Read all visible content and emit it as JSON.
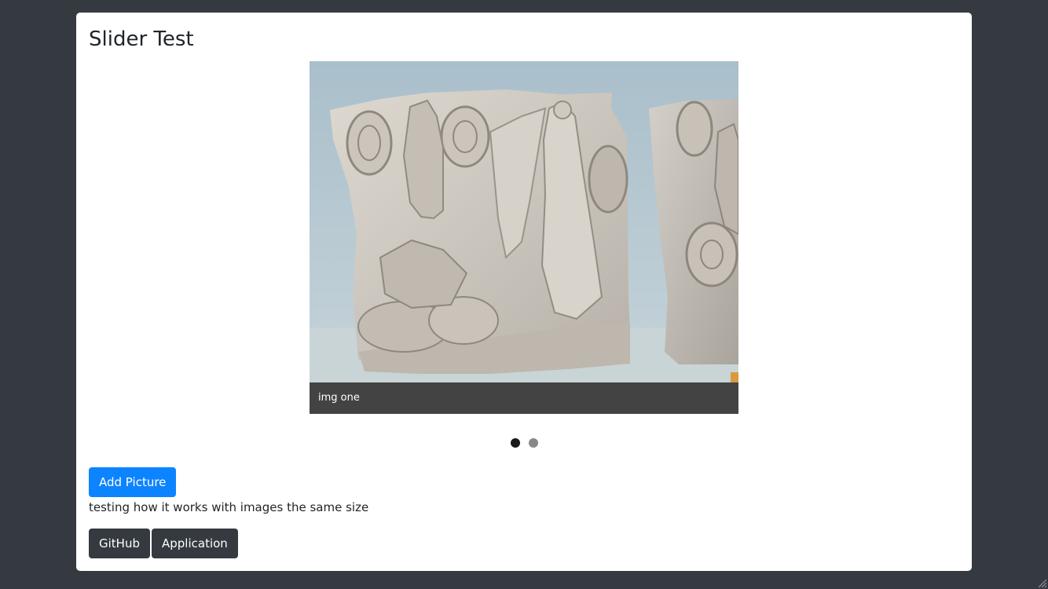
{
  "page": {
    "title": "Slider Test",
    "description": "testing how it works with images the same size"
  },
  "carousel": {
    "slides": [
      {
        "caption": "img one",
        "image": "relief-sculpture-image"
      },
      {
        "caption": "",
        "image": ""
      }
    ],
    "active_index": 0
  },
  "buttons": {
    "add_picture": "Add Picture",
    "github": "GitHub",
    "application": "Application"
  },
  "colors": {
    "background": "#343a40",
    "primary": "#0d84ff",
    "dark_button": "#343a40"
  },
  "icons": {
    "resize_grip": "resize-grip-icon"
  }
}
